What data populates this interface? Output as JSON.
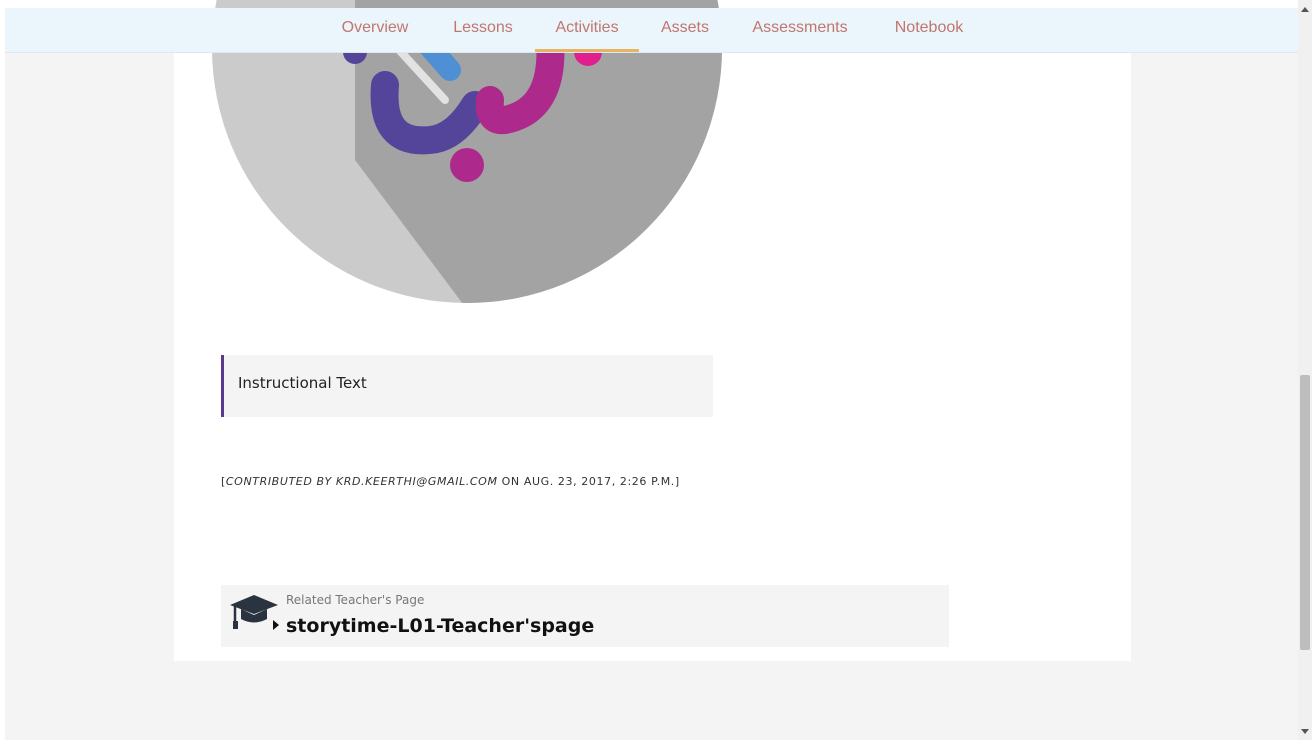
{
  "nav": {
    "tabs": [
      {
        "label": "Overview"
      },
      {
        "label": "Lessons"
      },
      {
        "label": "Activities"
      },
      {
        "label": "Assets"
      },
      {
        "label": "Assessments"
      },
      {
        "label": "Notebook"
      }
    ],
    "active_tab": "Activities"
  },
  "instruction": {
    "text": "Instructional Text"
  },
  "contribution": {
    "prefix": "[",
    "contributed_by": "CONTRIBUTED BY KRD.KEERTHI@GMAIL.COM",
    "date_text": " ON AUG. 23, 2017, 2:26 P.M.]"
  },
  "related": {
    "label": "Related Teacher's Page",
    "link_text": "storytime-L01-Teacher'spage"
  },
  "colors": {
    "nav_bg": "#eaf6fc",
    "nav_text": "#c2766e",
    "active_underline": "#e7b463",
    "accent_border": "#5b3a8c",
    "logo_purple": "#55459a",
    "logo_magenta": "#ad2a8c",
    "logo_pink": "#e0208c",
    "logo_blue": "#4f8fd3"
  }
}
